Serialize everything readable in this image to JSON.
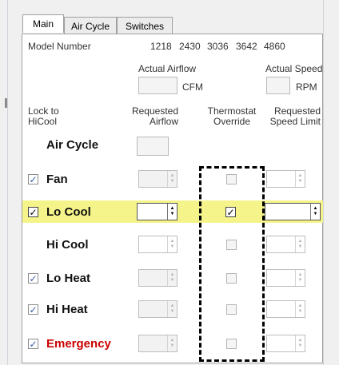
{
  "tabs": [
    "Main",
    "Air Cycle",
    "Switches"
  ],
  "model_number": {
    "label": "Model Number",
    "values": [
      "1218",
      "2430",
      "3036",
      "3642",
      "4860"
    ]
  },
  "actual_airflow": {
    "label": "Actual Airflow",
    "unit": "CFM"
  },
  "actual_speed": {
    "label": "Actual Speed",
    "unit": "RPM"
  },
  "headers": {
    "lock_line1": "Lock to",
    "lock_line2": "HiCool",
    "req_airflow_line1": "Requested",
    "req_airflow_line2": "Airflow",
    "thermostat_line1": "Thermostat",
    "thermostat_line2": "Override",
    "req_speed_line1": "Requested",
    "req_speed_line2": "Speed Limit"
  },
  "rows": [
    {
      "label": "Air Cycle"
    },
    {
      "label": "Fan",
      "lock_checked": true,
      "override_checked": false
    },
    {
      "label": "Lo Cool",
      "lock_checked": true,
      "override_checked": true,
      "highlighted": true
    },
    {
      "label": "Hi Cool",
      "override_checked": false
    },
    {
      "label": "Lo Heat",
      "lock_checked": true,
      "override_checked": false
    },
    {
      "label": "Hi Heat",
      "lock_checked": true,
      "override_checked": false
    },
    {
      "label": "Emergency",
      "lock_checked": true,
      "override_checked": false,
      "label_color": "#cc0000"
    }
  ],
  "glyphs": {
    "check": "✓",
    "up": "▲",
    "down": "▼"
  },
  "colors": {
    "highlight": "#f5f48a",
    "check": "#3a5fa8",
    "emergency": "#cc0000"
  }
}
